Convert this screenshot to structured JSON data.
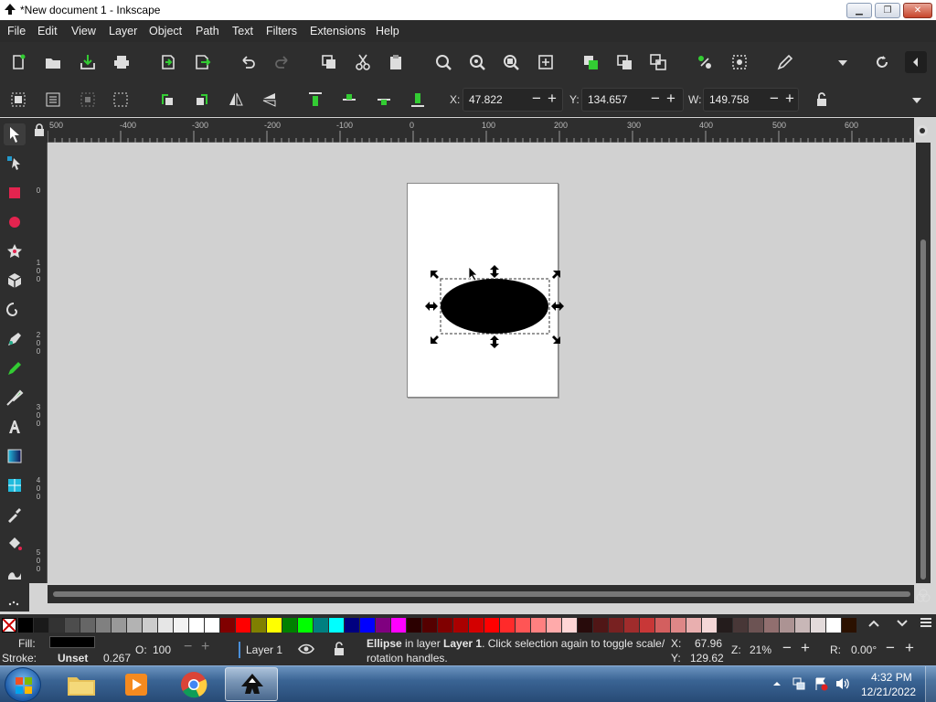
{
  "window": {
    "title": "*New document 1 - Inkscape",
    "controls": [
      "minimize",
      "maximize",
      "close"
    ]
  },
  "menu": [
    "File",
    "Edit",
    "View",
    "Layer",
    "Object",
    "Path",
    "Text",
    "Filters",
    "Extensions",
    "Help"
  ],
  "toolbar_commands": [
    "new-document-icon",
    "open-icon",
    "save-icon",
    "print-icon",
    "import-icon",
    "export-icon",
    "undo-icon",
    "redo-icon",
    "duplicate-icon",
    "cut-icon",
    "paste-icon",
    "zoom-selection-icon",
    "zoom-drawing-icon",
    "zoom-page-icon",
    "zoom-fit-icon",
    "group-icon",
    "ungroup-icon",
    "clone-icon",
    "transform-icon",
    "align-icon",
    "edit-icon",
    "more-dropdown-icon",
    "rotate-icon",
    "collapse-icon"
  ],
  "selector_controls": {
    "x_label": "X:",
    "x_value": "47.822",
    "y_label": "Y:",
    "y_value": "134.657",
    "w_label": "W:",
    "w_value": "149.758"
  },
  "tools": [
    "selector-tool-icon",
    "node-tool-icon",
    "rectangle-tool-icon",
    "ellipse-tool-icon",
    "star-tool-icon",
    "3d-box-tool-icon",
    "spiral-tool-icon",
    "pen-tool-icon",
    "pencil-tool-icon",
    "calligraphy-tool-icon",
    "text-tool-icon",
    "gradient-tool-icon",
    "mesh-tool-icon",
    "dropper-tool-icon",
    "paint-bucket-tool-icon",
    "tweak-tool-icon",
    "spray-tool-icon"
  ],
  "ruler": {
    "h_labels": [
      "500",
      "-400",
      "-300",
      "-200",
      "-100",
      "0",
      "100",
      "200",
      "300",
      "400",
      "500",
      "600"
    ],
    "v_labels": [
      "0",
      "1 0 0",
      "2 0 0",
      "3 0 0",
      "4 0 0",
      "5 0 0"
    ]
  },
  "palette_colors": [
    "#000000",
    "#1a1a1a",
    "#333333",
    "#4d4d4d",
    "#666666",
    "#808080",
    "#999999",
    "#b3b3b3",
    "#cccccc",
    "#e6e6e6",
    "#f2f2f2",
    "#ffffff",
    "#ffffff",
    "#800000",
    "#ff0000",
    "#808000",
    "#ffff00",
    "#008000",
    "#00ff00",
    "#008080",
    "#00ffff",
    "#000080",
    "#0000ff",
    "#800080",
    "#ff00ff",
    "#2b0000",
    "#550000",
    "#800000",
    "#aa0000",
    "#d40000",
    "#ff0000",
    "#ff2a2a",
    "#ff5555",
    "#ff8080",
    "#ffaaaa",
    "#ffd5d5",
    "#280b0b",
    "#501616",
    "#782121",
    "#a02c2c",
    "#c83737",
    "#d35f5f",
    "#de8787",
    "#e9afaf",
    "#f4d7d7",
    "#241c1c",
    "#483737",
    "#6c5353",
    "#916f6f",
    "#ac9393",
    "#c8b7b7",
    "#e3dbdb",
    "#ffffff",
    "#2b1100"
  ],
  "status": {
    "fill_label": "Fill:",
    "fill_color": "#000000",
    "stroke_label": "Stroke:",
    "stroke_value": "Unset",
    "stroke_width": "0.267",
    "opacity_label": "O:",
    "opacity_value": "100",
    "layer": "Layer 1",
    "message_obj": "Ellipse",
    "message_mid": " in layer ",
    "message_layer": "Layer 1",
    "message_rest": ". Click selection again to toggle scale/",
    "message_line2": "rotation handles.",
    "x_label": "X:",
    "cursor_x": "67.96",
    "y_label": "Y:",
    "cursor_y": "129.62",
    "zoom_label": "Z:",
    "zoom": "21%",
    "rotate_label": "R:",
    "rotation": "0.00°"
  },
  "taskbar": {
    "apps": [
      "start-button",
      "file-explorer",
      "media-player",
      "chrome",
      "inkscape"
    ],
    "time": "4:32 PM",
    "date": "12/21/2022"
  }
}
